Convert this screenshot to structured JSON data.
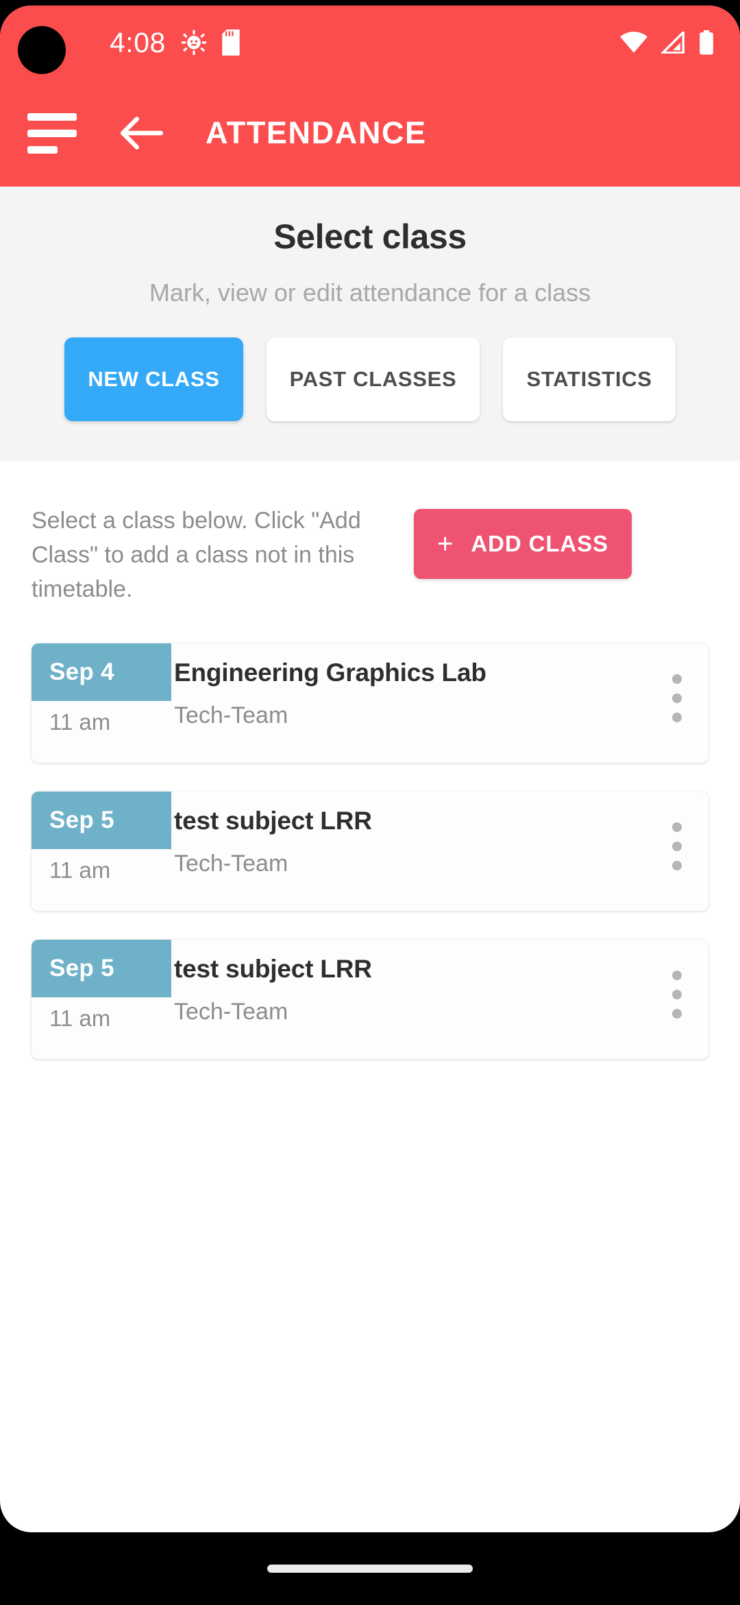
{
  "status_bar": {
    "time": "4:08",
    "icons": [
      "android-debug-icon",
      "sd-card-icon",
      "wifi-icon",
      "cellular-signal-icon",
      "battery-icon"
    ]
  },
  "app_bar": {
    "menu_icon": "hamburger-menu-icon",
    "back_icon": "back-arrow-icon",
    "title": "ATTENDANCE",
    "background_color": "#fb4d4d"
  },
  "hero": {
    "title": "Select class",
    "subtitle": "Mark, view or edit attendance for a class",
    "background_color": "#f4f4f4",
    "tabs": [
      {
        "label": "NEW CLASS",
        "active": true
      },
      {
        "label": "PAST CLASSES",
        "active": false
      },
      {
        "label": "STATISTICS",
        "active": false
      }
    ],
    "active_tab_color": "#33a9f7"
  },
  "instruction": {
    "text": "Select a class below. Click \"Add Class\" to add a class not in this timetable."
  },
  "add_class_button": {
    "plus": "+",
    "label": "ADD CLASS",
    "color": "#ee5372"
  },
  "classes": [
    {
      "date": "Sep 4",
      "time": "11 am",
      "title": "Engineering Graphics Lab",
      "subtitle": "Tech-Team",
      "badge_color": "#6fb1c9"
    },
    {
      "date": "Sep 5",
      "time": "11 am",
      "title": "test subject LRR",
      "subtitle": "Tech-Team",
      "badge_color": "#6fb1c9"
    },
    {
      "date": "Sep 5",
      "time": "11 am",
      "title": "test subject LRR",
      "subtitle": "Tech-Team",
      "badge_color": "#6fb1c9"
    }
  ],
  "nav_bar": {
    "home_indicator": "home-indicator-pill"
  }
}
